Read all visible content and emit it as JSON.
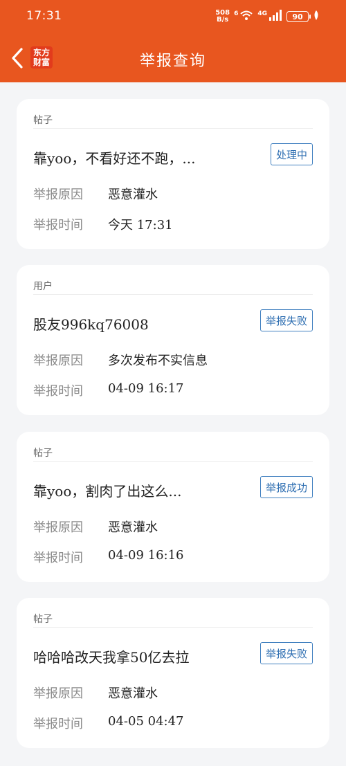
{
  "status_bar": {
    "time": "17:31",
    "net_speed_top": "508",
    "net_speed_bottom": "B/s",
    "wifi_label": "6",
    "cell_label": "4G",
    "battery": "90"
  },
  "nav": {
    "title": "举报查询",
    "logo_line1": "东方",
    "logo_line2": "财富"
  },
  "labels": {
    "reason": "举报原因",
    "time": "举报时间"
  },
  "reports": [
    {
      "type": "帖子",
      "title": "靠yoo，不看好还不跑，...",
      "status": "处理中",
      "reason": "恶意灌水",
      "time": "今天 17:31"
    },
    {
      "type": "用户",
      "title": "股友996kq76008",
      "status": "举报失败",
      "reason": "多次发布不实信息",
      "time": "04-09 16:17"
    },
    {
      "type": "帖子",
      "title": "靠yoo，割肉了出这么...",
      "status": "举报成功",
      "reason": "恶意灌水",
      "time": "04-09 16:16"
    },
    {
      "type": "帖子",
      "title": "哈哈哈改天我拿50亿去拉",
      "status": "举报失败",
      "reason": "恶意灌水",
      "time": "04-05 04:47"
    }
  ],
  "colors": {
    "header": "#e8561f",
    "badge": "#2f6fb2",
    "background": "#f4f5f7"
  }
}
